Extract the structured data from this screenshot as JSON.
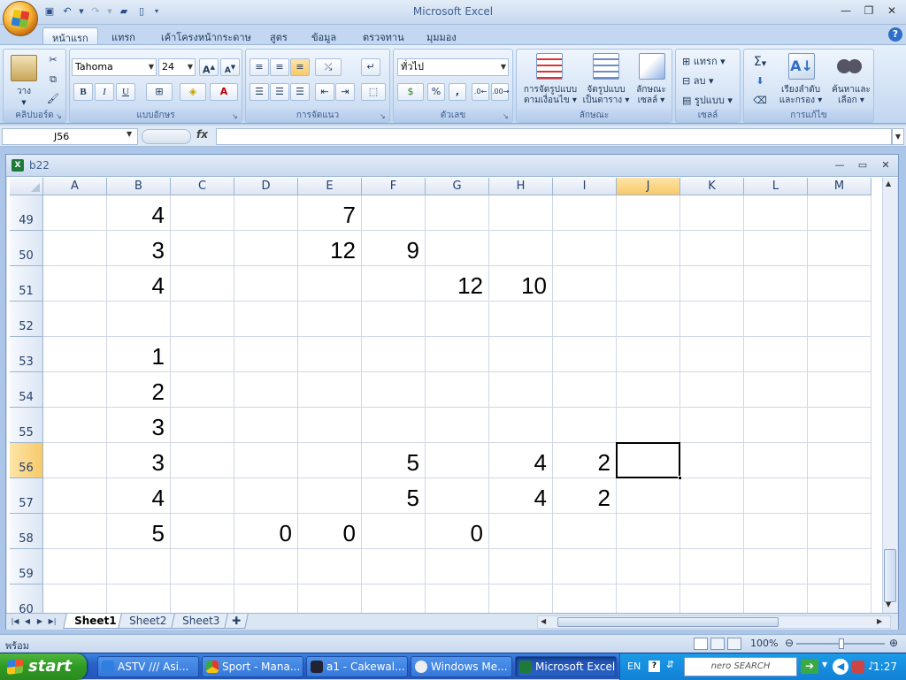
{
  "app": {
    "title": "Microsoft Excel"
  },
  "ribbon_tabs": [
    "หน้าแรก",
    "แทรก",
    "เค้าโครงหน้ากระดาษ",
    "สูตร",
    "ข้อมูล",
    "ตรวจทาน",
    "มุมมอง"
  ],
  "ribbon": {
    "clipboard": {
      "paste_label": "วาง",
      "group_label": "คลิปบอร์ด"
    },
    "font": {
      "name": "Tahoma",
      "size": "24",
      "group_label": "แบบอักษร",
      "bold": "B",
      "italic": "I",
      "underline": "U",
      "grow": "A",
      "shrink": "A"
    },
    "alignment": {
      "group_label": "การจัดแนว"
    },
    "number": {
      "format": "ทั่วไป",
      "group_label": "ตัวเลข",
      "percent": "%",
      "comma": ","
    },
    "styles": {
      "group_label": "ลักษณะ",
      "cond_format_1": "การจัดรูปแบบ",
      "cond_format_2": "ตามเงื่อนไข",
      "table_format_1": "จัดรูปแบบ",
      "table_format_2": "เป็นตาราง",
      "cell_style_1": "ลักษณะ",
      "cell_style_2": "เซลล์"
    },
    "cells": {
      "group_label": "เซลล์",
      "insert": "แทรก",
      "delete": "ลบ",
      "format": "รูปแบบ"
    },
    "editing": {
      "group_label": "การแก้ไข",
      "sort_1": "เรียงลำดับ",
      "sort_2": "และกรอง",
      "find_1": "ค้นหาและ",
      "find_2": "เลือก",
      "sigma": "Σ"
    }
  },
  "formula_bar": {
    "name_box": "J56",
    "fx": "fx",
    "value": ""
  },
  "workbook": {
    "title": "b22"
  },
  "grid": {
    "columns": [
      "A",
      "B",
      "C",
      "D",
      "E",
      "F",
      "G",
      "H",
      "I",
      "J",
      "K",
      "L",
      "M"
    ],
    "selected_column": "J",
    "selected_row": "56",
    "rows": [
      {
        "num": "49",
        "cells": {
          "B": "4",
          "E": "7"
        }
      },
      {
        "num": "50",
        "cells": {
          "B": "3",
          "E": "12",
          "F": "9"
        }
      },
      {
        "num": "51",
        "cells": {
          "B": "4",
          "G": "12",
          "H": "10"
        }
      },
      {
        "num": "52",
        "cells": {}
      },
      {
        "num": "53",
        "cells": {
          "B": "1"
        }
      },
      {
        "num": "54",
        "cells": {
          "B": "2"
        }
      },
      {
        "num": "55",
        "cells": {
          "B": "3"
        }
      },
      {
        "num": "56",
        "cells": {
          "B": "3",
          "F": "5",
          "H": "4",
          "I": "2"
        }
      },
      {
        "num": "57",
        "cells": {
          "B": "4",
          "F": "5",
          "H": "4",
          "I": "2"
        }
      },
      {
        "num": "58",
        "cells": {
          "B": "5",
          "D": "0",
          "E": "0",
          "G": "0"
        }
      },
      {
        "num": "59",
        "cells": {}
      },
      {
        "num": "60",
        "cells": {}
      }
    ]
  },
  "sheets": [
    "Sheet1",
    "Sheet2",
    "Sheet3"
  ],
  "active_sheet": "Sheet1",
  "status": {
    "text": "พร้อม",
    "zoom": "100%"
  },
  "taskbar": {
    "start": "start",
    "tasks": [
      "ASTV /// Asi...",
      "Sport - Mana...",
      "a1 - Cakewal...",
      "Windows Me...",
      "Microsoft Excel"
    ],
    "active_task": "Microsoft Excel",
    "lang": "EN",
    "search_brand": "nero SEARCH",
    "clock": "1:27"
  },
  "colors": {
    "accent": "#15428b",
    "selection": "#f7c96a",
    "taskbar": "#2a62c8"
  }
}
